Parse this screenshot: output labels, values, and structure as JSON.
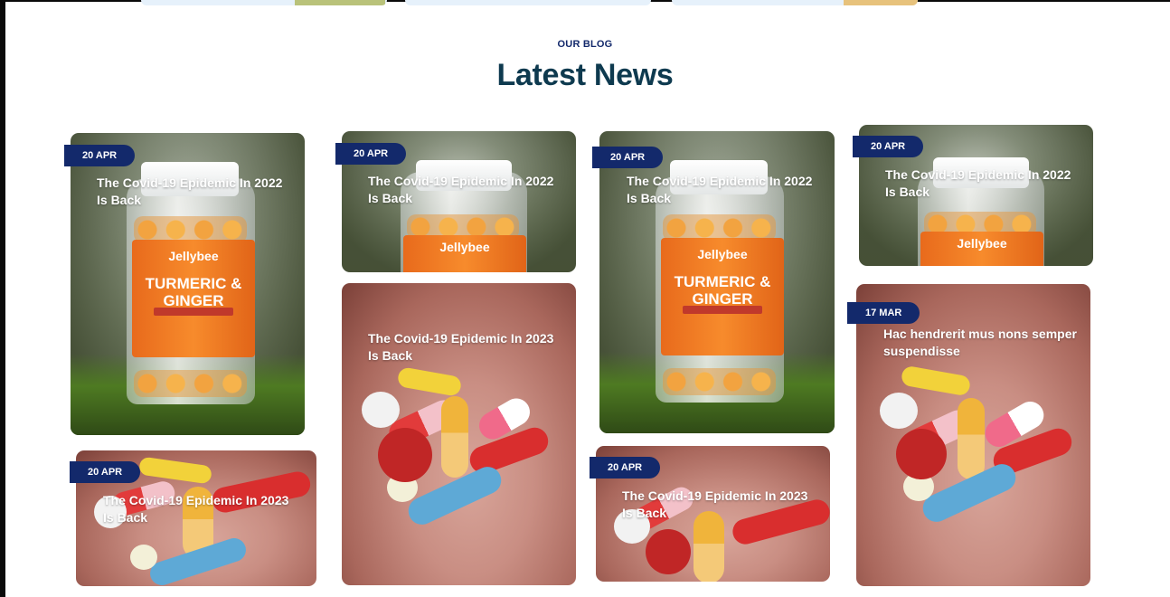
{
  "section": {
    "kicker": "OUR BLOG",
    "title": "Latest News"
  },
  "posts": [
    {
      "date": "20 APR",
      "title": "The Covid-19 Epidemic In 2022 Is Back",
      "image": "turmeric-ginger-bottle"
    },
    {
      "date": "20 APR",
      "title": "The Covid-19 Epidemic In 2023 Is Back",
      "image": "pills-in-hand"
    },
    {
      "date": "20 APR",
      "title": "The Covid-19 Epidemic In 2022 Is Back",
      "image": "turmeric-ginger-bottle"
    },
    {
      "date": "20 APR",
      "title": "The Covid-19 Epidemic In 2023 Is Back",
      "image": "pills-in-hand"
    },
    {
      "date": "20 APR",
      "title": "The Covid-19 Epidemic In 2022 Is Back",
      "image": "turmeric-ginger-bottle"
    },
    {
      "date": "20 APR",
      "title": "The Covid-19 Epidemic In 2023 Is Back",
      "image": "pills-in-hand"
    },
    {
      "date": "20 APR",
      "title": "The Covid-19 Epidemic In 2022 Is Back",
      "image": "turmeric-ginger-bottle"
    },
    {
      "date": "17 MAR",
      "title": "Hac hendrerit mus nons semper suspendisse",
      "image": "pills-in-hand"
    }
  ],
  "bottle_label": {
    "brand": "Jellybee",
    "product": "TURMERIC & GINGER"
  },
  "colors": {
    "badge": "#13296b",
    "heading": "#0e3a4f",
    "kicker": "#13296b"
  }
}
